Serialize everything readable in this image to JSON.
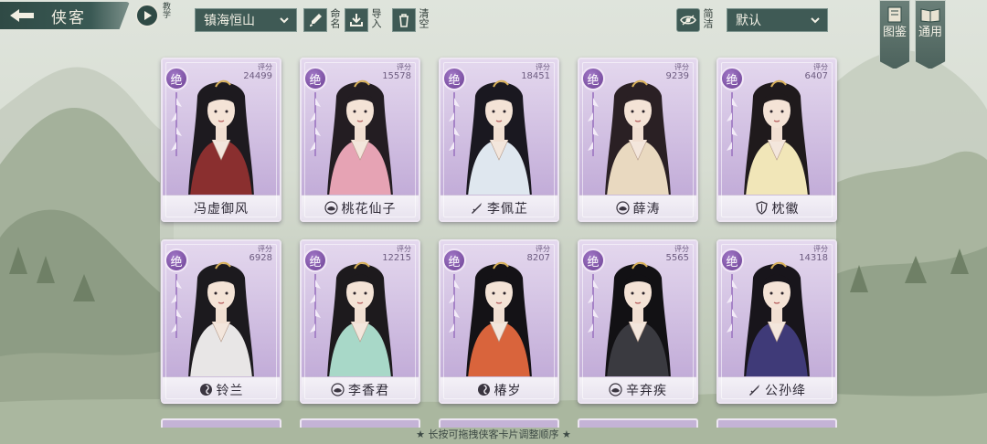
{
  "header": {
    "back_title": "侠客",
    "tutorial_label": "教学",
    "preset": "镇海恒山",
    "tools": [
      {
        "id": "rename",
        "label": "命名",
        "icon": "brush-icon"
      },
      {
        "id": "import",
        "label": "导入",
        "icon": "import-icon"
      },
      {
        "id": "clear",
        "label": "清空",
        "icon": "trash-icon"
      }
    ],
    "simple_label": "简洁",
    "sort": "默认",
    "banners": [
      {
        "label": "图鉴",
        "icon": "book-icon"
      },
      {
        "label": "通用",
        "icon": "open-book-icon"
      }
    ]
  },
  "score_label": "评分",
  "rarity_label": "绝",
  "cards": [
    {
      "name": "冯虚御风",
      "score": "24499",
      "sect_icon": "none",
      "robe": "#8a2f2f",
      "hair": "#1d1a1f"
    },
    {
      "name": "桃花仙子",
      "score": "15578",
      "sect_icon": "lotus-sect-icon",
      "robe": "#e6a3b4",
      "hair": "#231d22"
    },
    {
      "name": "李佩芷",
      "score": "18451",
      "sect_icon": "sword-sect-icon",
      "robe": "#dfe7ef",
      "hair": "#1a1820"
    },
    {
      "name": "薛涛",
      "score": "9239",
      "sect_icon": "lotus-sect-icon",
      "robe": "#e9d9c0",
      "hair": "#2a2024"
    },
    {
      "name": "枕徽",
      "score": "6407",
      "sect_icon": "shield-sect-icon",
      "robe": "#f1e6b8",
      "hair": "#1f1a1c"
    },
    {
      "name": "铃兰",
      "score": "6928",
      "sect_icon": "swirl-sect-icon",
      "robe": "#e8e6e6",
      "hair": "#1c1a1e"
    },
    {
      "name": "李香君",
      "score": "12215",
      "sect_icon": "lotus-sect-icon",
      "robe": "#a8d8c8",
      "hair": "#1d1a1d"
    },
    {
      "name": "椿岁",
      "score": "8207",
      "sect_icon": "swirl-sect-icon",
      "robe": "#d9643c",
      "hair": "#141216"
    },
    {
      "name": "辛弃疾",
      "score": "5565",
      "sect_icon": "lotus-sect-icon",
      "robe": "#3a3a40",
      "hair": "#121114"
    },
    {
      "name": "公孙绛",
      "score": "14318",
      "sect_icon": "sword-sect-icon",
      "robe": "#3f3a78",
      "hair": "#18151b"
    }
  ],
  "footer_hint": "★ 长按可拖拽侠客卡片调整顺序 ★",
  "colors": {
    "accent_dark": "#3f5a55",
    "card_purple": "#c5b2da",
    "rarity_purple": "#6b3f93"
  }
}
